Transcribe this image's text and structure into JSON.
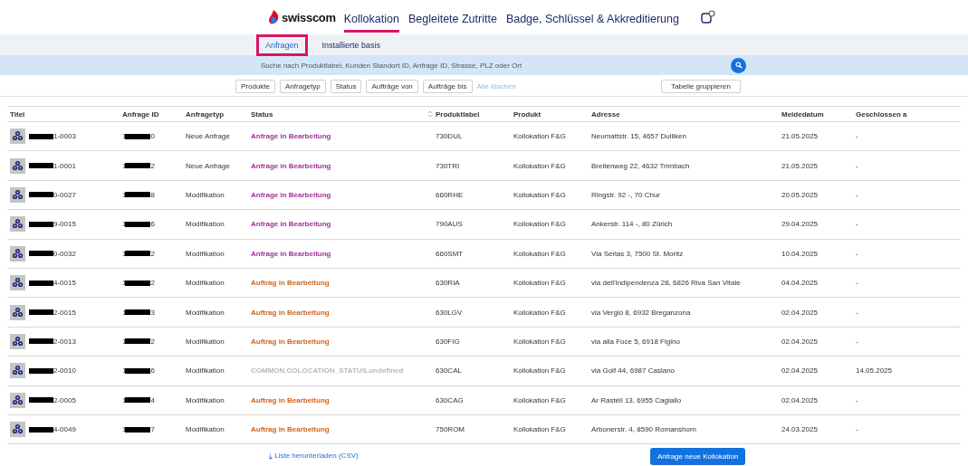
{
  "header": {
    "brand": "swisscom",
    "nav": [
      {
        "label": "Kollokation",
        "selected": true
      },
      {
        "label": "Begleitete Zutritte",
        "selected": false
      },
      {
        "label": "Badge, Schlüssel & Akkreditierung",
        "selected": false
      }
    ]
  },
  "subnav": [
    {
      "label": "Anfragen",
      "selected": true
    },
    {
      "label": "Installierte basis",
      "selected": false
    }
  ],
  "search": {
    "placeholder": "Suche nach Produktlabel, Kunden Standort ID, Anfrage ID, Strasse, PLZ oder Ort"
  },
  "filters": [
    "Produkte",
    "Anfragetyp",
    "Status",
    "Aufträge von",
    "Aufträge bis"
  ],
  "clear_filters": "Alle löschen",
  "group_button": "Tabelle gruppieren",
  "table": {
    "columns": [
      "Titel",
      "Anfrage ID",
      "Anfragetyp",
      "Status",
      "Produktlabel",
      "Produkt",
      "Adresse",
      "Meldedatum",
      "Geschlossen a"
    ],
    "rows": [
      {
        "title": "1-0003",
        "id_start": "1",
        "id_end": "0",
        "type": "Neue Anfrage",
        "status": "Anfrage in Bearbeitung",
        "color": "#a0309a",
        "label": "730DUL",
        "product": "Kollokation F&G",
        "address": "Neumattstr. 15, 4657 Dulliken",
        "reported": "21.05.2025",
        "closed": "-"
      },
      {
        "title": "1-0001",
        "id_start": "1",
        "id_end": "2",
        "type": "Neue Anfrage",
        "status": "Anfrage in Bearbeitung",
        "color": "#a0309a",
        "label": "730TRI",
        "product": "Kollokation F&G",
        "address": "Breitenweg 22, 4632 Trimbach",
        "reported": "21.05.2025",
        "closed": "-"
      },
      {
        "title": "0-0027",
        "id_start": "1",
        "id_end": "8",
        "type": "Modifikation",
        "status": "Anfrage in Bearbeitung",
        "color": "#a0309a",
        "label": "660RHE",
        "product": "Kollokation F&G",
        "address": "Ringstr. 92 -, 70 Chur",
        "reported": "20.05.2025",
        "closed": "-"
      },
      {
        "title": "9-0015",
        "id_start": "1",
        "id_end": "6",
        "type": "Modifikation",
        "status": "Anfrage in Bearbeitung",
        "color": "#a0309a",
        "label": "790AUS",
        "product": "Kollokation F&G",
        "address": "Ankerstr. 114 -, 80 Zürich",
        "reported": "29.04.2025",
        "closed": "-"
      },
      {
        "title": "0-0032",
        "id_start": "1",
        "id_end": "2",
        "type": "Modifikation",
        "status": "Anfrage in Bearbeitung",
        "color": "#a0309a",
        "label": "660SMT",
        "product": "Kollokation F&G",
        "address": "Via Serlas 3, 7500 St. Moritz",
        "reported": "10.04.2025",
        "closed": "-"
      },
      {
        "title": "4-0015",
        "id_start": "1",
        "id_end": "2",
        "type": "Modifikation",
        "status": "Auftrag in Bearbeitung",
        "color": "#d0621c",
        "label": "630RIA",
        "product": "Kollokation F&G",
        "address": "via dell'Indipendenza 28, 6826 Riva San Vitale",
        "reported": "04.04.2025",
        "closed": "-"
      },
      {
        "title": "2-0015",
        "id_start": "1",
        "id_end": "3",
        "type": "Modifikation",
        "status": "Auftrag in Bearbeitung",
        "color": "#d0621c",
        "label": "630LGV",
        "product": "Kollokation F&G",
        "address": "via Vergiò 8, 6932 Breganzona",
        "reported": "02.04.2025",
        "closed": "-"
      },
      {
        "title": "2-0013",
        "id_start": "1",
        "id_end": "2",
        "type": "Modifikation",
        "status": "Auftrag in Bearbeitung",
        "color": "#d0621c",
        "label": "630FIG",
        "product": "Kollokation F&G",
        "address": "via alla Foce 5, 6918 Figino",
        "reported": "02.04.2025",
        "closed": "-"
      },
      {
        "title": "2-0010",
        "id_start": "1",
        "id_end": "6",
        "type": "Modifikation",
        "status": "COMMON.COLOCATION_STATUS.undefined",
        "color": "#b4b9bf",
        "label": "630CAL",
        "product": "Kollokation F&G",
        "address": "via Golf 44, 6987 Caslano",
        "reported": "02.04.2025",
        "closed": "14.05.2025"
      },
      {
        "title": "2-0005",
        "id_start": "1",
        "id_end": "4",
        "type": "Modifikation",
        "status": "Auftrag in Bearbeitung",
        "color": "#d0621c",
        "label": "630CAG",
        "product": "Kollokation F&G",
        "address": "Ar Rastèll 13, 6955 Cagiallo",
        "reported": "02.04.2025",
        "closed": "-"
      },
      {
        "title": "4-0049",
        "id_start": "1",
        "id_end": "7",
        "type": "Modifikation",
        "status": "Auftrag in Bearbeitung",
        "color": "#d0621c",
        "label": "750ROM",
        "product": "Kollokation F&G",
        "address": "Arbonerstr. 4, 8590 Romanshorn",
        "reported": "24.03.2025",
        "closed": "-"
      }
    ]
  },
  "footer": {
    "download_link": "⤓ Liste herunterladen (CSV)",
    "new_button": "Anfrage neue Kollokation"
  }
}
